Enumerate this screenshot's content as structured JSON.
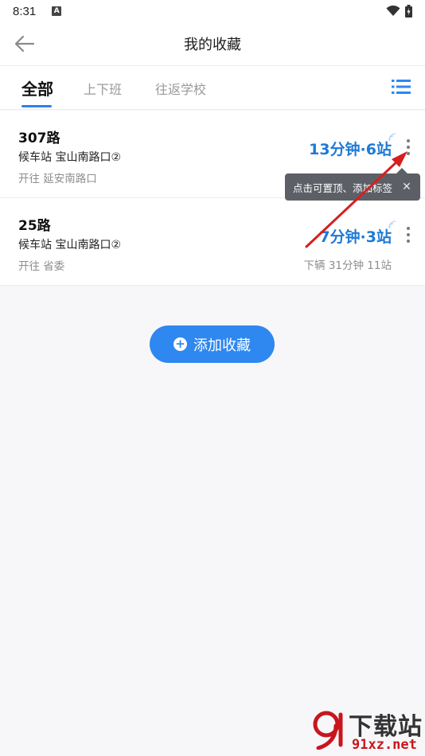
{
  "status_bar": {
    "time": "8:31",
    "notification_icon": "A"
  },
  "header": {
    "title": "我的收藏",
    "back_icon": "arrow-left-icon"
  },
  "tabs": [
    {
      "label": "全部",
      "active": true
    },
    {
      "label": "上下班",
      "active": false
    },
    {
      "label": "往返学校",
      "active": false
    }
  ],
  "favorites": [
    {
      "route": "307路",
      "stop": "候车站 宝山南路口②",
      "direction": "开往 延安南路口",
      "eta": "13分钟·6站",
      "next_bus": ""
    },
    {
      "route": "25路",
      "stop": "候车站 宝山南路口②",
      "direction": "开往 省委",
      "eta": "7分钟·3站",
      "next_bus": "下辆  31分钟 11站"
    }
  ],
  "tooltip": {
    "text": "点击可置顶、添加标签",
    "close": "✕"
  },
  "add_button": {
    "label": "添加收藏"
  },
  "watermark": {
    "top": "下载站",
    "bottom": "91xz.net"
  },
  "colors": {
    "accent": "#2f87f0",
    "eta": "#1e7ad6",
    "annotation": "#d61f1f"
  }
}
